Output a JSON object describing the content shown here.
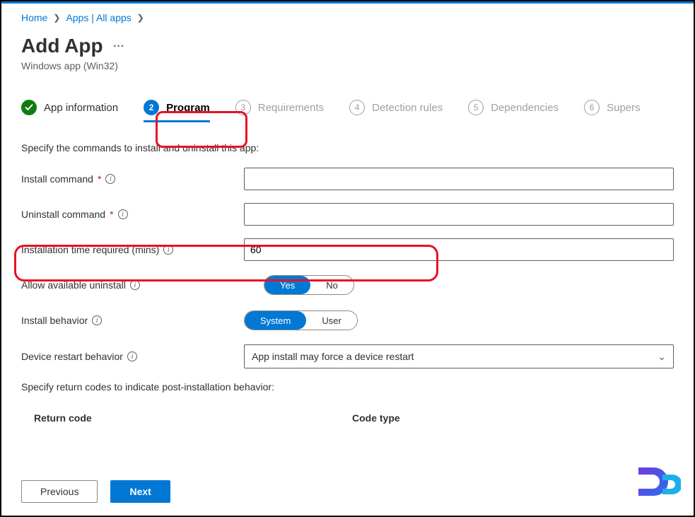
{
  "breadcrumb": {
    "home": "Home",
    "apps": "Apps | All apps"
  },
  "header": {
    "title": "Add App",
    "subtitle": "Windows app (Win32)"
  },
  "wizard": {
    "steps": [
      {
        "num": "",
        "label": "App information"
      },
      {
        "num": "2",
        "label": "Program"
      },
      {
        "num": "3",
        "label": "Requirements"
      },
      {
        "num": "4",
        "label": "Detection rules"
      },
      {
        "num": "5",
        "label": "Dependencies"
      },
      {
        "num": "6",
        "label": "Supers"
      }
    ]
  },
  "section1_text": "Specify the commands to install and uninstall this app:",
  "fields": {
    "install_cmd_label": "Install command",
    "install_cmd_value": "",
    "uninstall_cmd_label": "Uninstall command",
    "uninstall_cmd_value": "",
    "install_time_label": "Installation time required (mins)",
    "install_time_value": "60",
    "allow_uninstall_label": "Allow available uninstall",
    "allow_uninstall_yes": "Yes",
    "allow_uninstall_no": "No",
    "install_behavior_label": "Install behavior",
    "install_behavior_system": "System",
    "install_behavior_user": "User",
    "restart_label": "Device restart behavior",
    "restart_value": "App install may force a device restart"
  },
  "section2_text": "Specify return codes to indicate post-installation behavior:",
  "table": {
    "col1": "Return code",
    "col2": "Code type"
  },
  "footer": {
    "previous": "Previous",
    "next": "Next"
  }
}
